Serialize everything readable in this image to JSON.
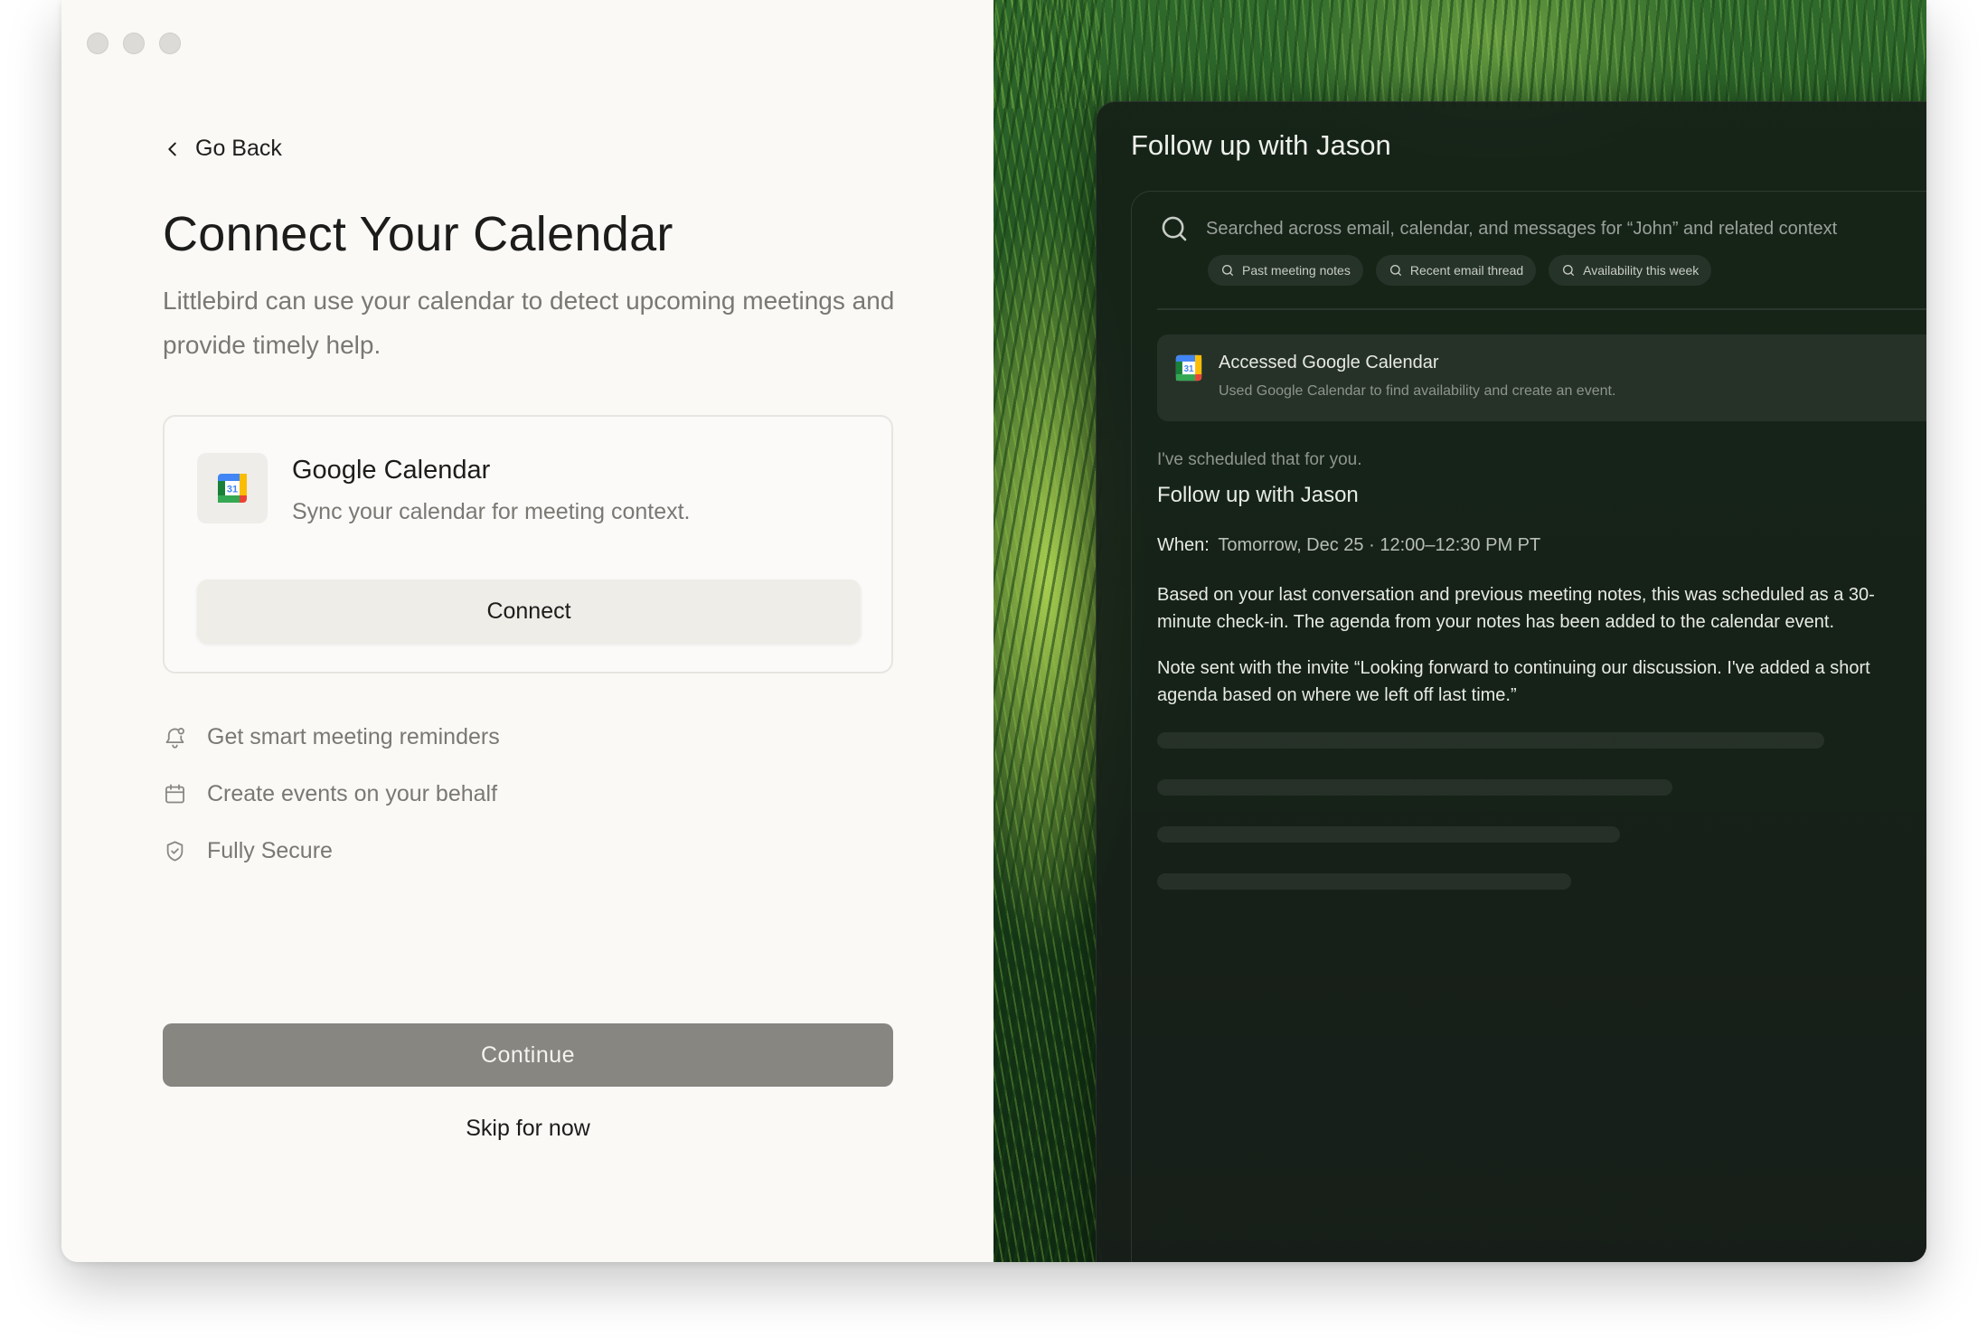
{
  "window": {
    "traffic_lights": [
      "close",
      "minimize",
      "zoom"
    ]
  },
  "onboarding": {
    "back_label": "Go Back",
    "title": "Connect Your Calendar",
    "subtitle": "Littlebird can use your calendar to detect upcoming meetings and provide timely help.",
    "integration": {
      "name": "Google Calendar",
      "description": "Sync your calendar for meeting context.",
      "icon": "google-calendar-icon",
      "icon_day": "31",
      "connect_label": "Connect"
    },
    "features": [
      {
        "label": "Get smart meeting reminders",
        "icon": "bell-icon"
      },
      {
        "label": "Create events on your behalf",
        "icon": "calendar-icon"
      },
      {
        "label": "Fully Secure",
        "icon": "shield-check-icon"
      }
    ],
    "continue_label": "Continue",
    "skip_label": "Skip for now"
  },
  "preview": {
    "title": "Follow up with Jason",
    "search_text": "Searched across email, calendar, and messages for “John” and related context",
    "chips": [
      "Past meeting notes",
      "Recent email thread",
      "Availability this week"
    ],
    "tool": {
      "title": "Accessed Google Calendar",
      "description": "Used Google Calendar to find availability and create an event.",
      "icon_day": "31"
    },
    "intro": "I've scheduled that for you.",
    "event_title": "Follow up with Jason",
    "when_label": "When:",
    "when_value": "Tomorrow, Dec 25 · 12:00–12:30 PM PT",
    "paragraph1": "Based on your last conversation and previous meeting notes, this was scheduled as a 30-minute check-in. The agenda from your notes has been added to the calendar event.",
    "paragraph2": "Note sent with the invite “Looking forward to continuing our discussion. I've added a short agenda based on where we left off last time.”"
  },
  "colors": {
    "background": "#faf9f6",
    "continue_button": "#878680",
    "panel": "#162218",
    "grass": "#2f6a2c"
  }
}
